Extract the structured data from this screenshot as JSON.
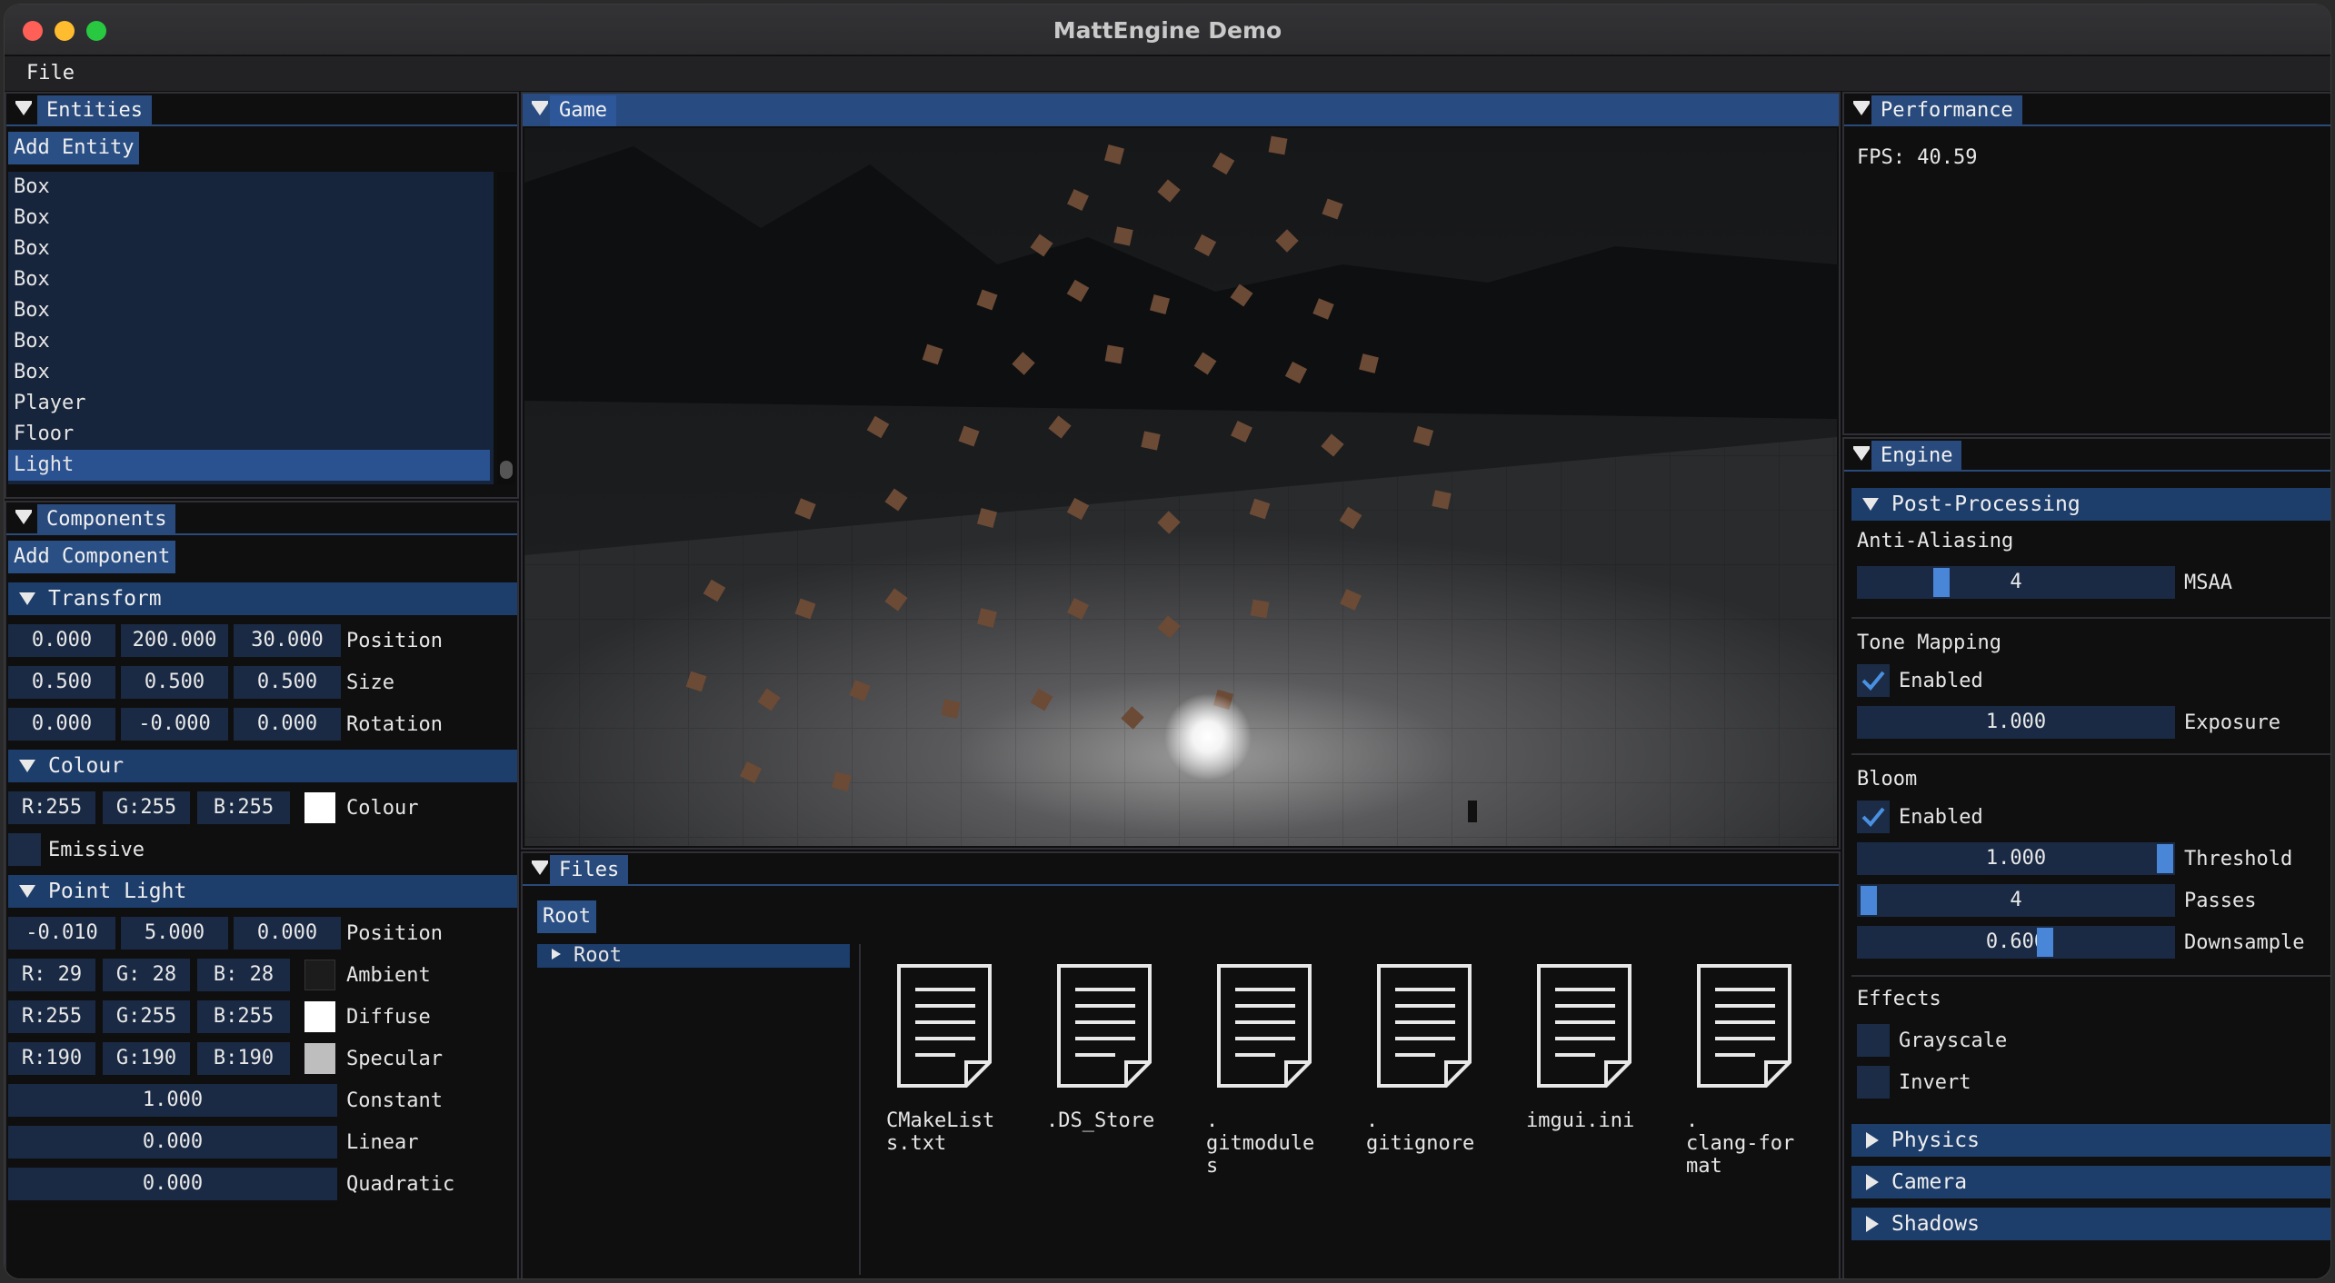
{
  "window": {
    "title": "MattEngine Demo"
  },
  "menu": {
    "file": "File"
  },
  "entities": {
    "tab": "Entities",
    "add_button": "Add Entity",
    "items": [
      "Box",
      "Box",
      "Box",
      "Box",
      "Box",
      "Box",
      "Box",
      "Player",
      "Floor",
      "Light"
    ],
    "selected_index": 9
  },
  "components": {
    "tab": "Components",
    "add_button": "Add Component",
    "transform": {
      "header": "Transform",
      "position": [
        "0.000",
        "200.000",
        "30.000"
      ],
      "position_label": "Position",
      "size": [
        "0.500",
        "0.500",
        "0.500"
      ],
      "size_label": "Size",
      "rotation": [
        "0.000",
        "-0.000",
        "0.000"
      ],
      "rotation_label": "Rotation"
    },
    "colour": {
      "header": "Colour",
      "rgb": [
        "R:255",
        "G:255",
        "B:255"
      ],
      "label": "Colour",
      "swatch": "#ffffff",
      "emissive_label": "Emissive"
    },
    "point_light": {
      "header": "Point Light",
      "position": [
        "-0.010",
        "5.000",
        "0.000"
      ],
      "position_label": "Position",
      "ambient": [
        "R: 29",
        "G: 28",
        "B: 28"
      ],
      "ambient_label": "Ambient",
      "ambient_swatch": "#1d1c1c",
      "diffuse": [
        "R:255",
        "G:255",
        "B:255"
      ],
      "diffuse_label": "Diffuse",
      "diffuse_swatch": "#ffffff",
      "specular": [
        "R:190",
        "G:190",
        "B:190"
      ],
      "specular_label": "Specular",
      "specular_swatch": "#bebebe",
      "constant": "1.000",
      "constant_label": "Constant",
      "linear": "0.000",
      "linear_label": "Linear",
      "quadratic": "0.000",
      "quadratic_label": "Quadratic"
    }
  },
  "game": {
    "tab": "Game"
  },
  "files": {
    "tab": "Files",
    "root_button": "Root",
    "tree_root": "Root",
    "items": [
      "CMakeList\ns.txt",
      ".DS_Store",
      ".\ngitmodule\ns",
      ".\ngitignore",
      "imgui.ini",
      ".\nclang-for\nmat"
    ]
  },
  "performance": {
    "tab": "Performance",
    "fps": "FPS: 40.59"
  },
  "engine": {
    "tab": "Engine",
    "post_processing": "Post-Processing",
    "anti_aliasing": "Anti-Aliasing",
    "msaa_value": "4",
    "msaa_label": "MSAA",
    "tone_mapping": "Tone Mapping",
    "tone_enabled": "Enabled",
    "exposure_value": "1.000",
    "exposure_label": "Exposure",
    "bloom": "Bloom",
    "bloom_enabled": "Enabled",
    "threshold_value": "1.000",
    "threshold_label": "Threshold",
    "passes_value": "4",
    "passes_label": "Passes",
    "downsample_value": "0.600",
    "downsample_label": "Downsample",
    "effects": "Effects",
    "grayscale": "Grayscale",
    "invert": "Invert",
    "physics": "Physics",
    "camera": "Camera",
    "shadows": "Shadows"
  },
  "colors": {
    "accent": "#284c82",
    "field": "#1a2a44",
    "check": "#4a90e2"
  }
}
